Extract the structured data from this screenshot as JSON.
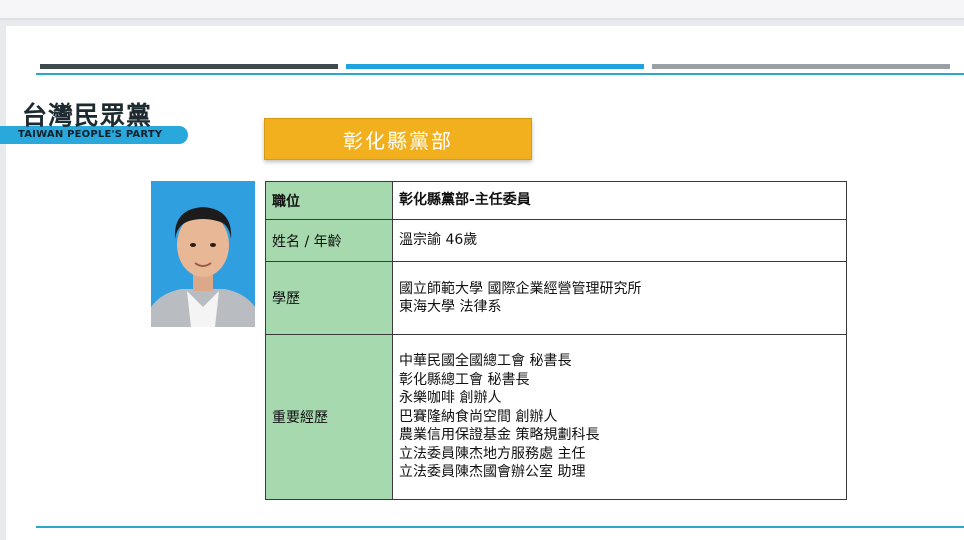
{
  "logo": {
    "zh": "台灣民眾黨",
    "en": "TAIWAN PEOPLE'S PARTY"
  },
  "branch_title": "彰化縣黨部",
  "table": {
    "position": {
      "label": "職位",
      "value": "彰化縣黨部-主任委員"
    },
    "name_age": {
      "label": "姓名 / 年齡",
      "value": "溫宗諭 46歲"
    },
    "education": {
      "label": "學歷",
      "lines": [
        "國立師範大學 國際企業經營管理研究所",
        "東海大學 法律系"
      ]
    },
    "experience": {
      "label": "重要經歷",
      "lines": [
        "中華民國全國總工會 秘書長",
        "彰化縣總工會 秘書長",
        "永樂咖啡 創辦人",
        "巴賽隆納食尚空間 創辦人",
        "農業信用保證基金 策略規劃科長",
        "立法委員陳杰地方服務處 主任",
        "立法委員陳杰國會辦公室 助理"
      ]
    }
  },
  "colors": {
    "accent_blue": "#1fa2dd",
    "branch_yellow": "#f2b01e",
    "label_green": "#a6d9ae"
  }
}
